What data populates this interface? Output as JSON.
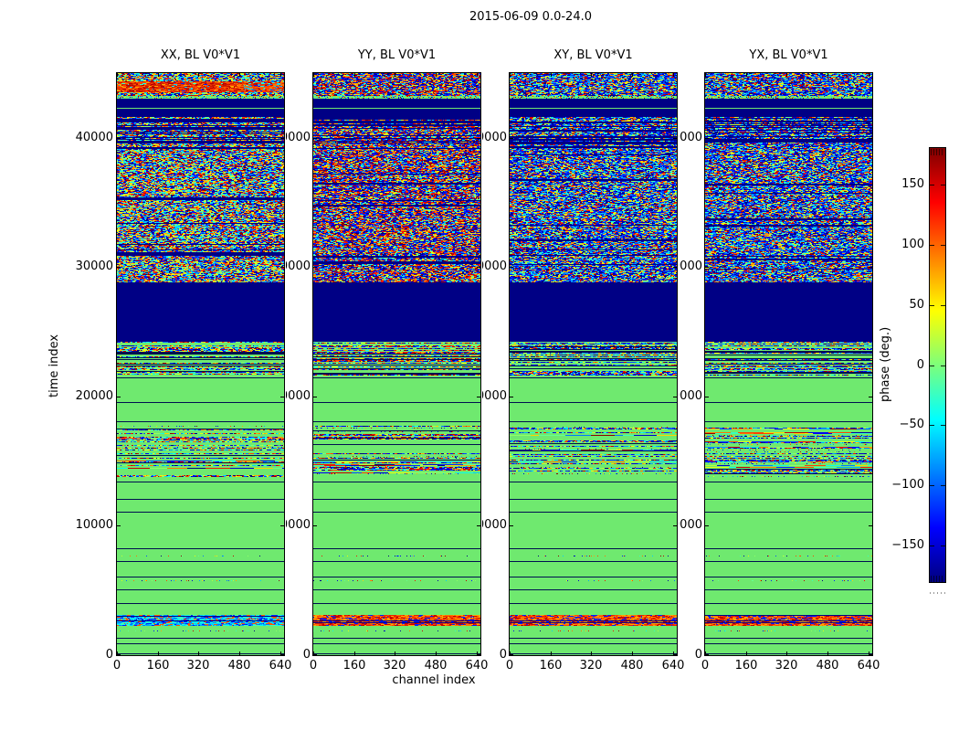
{
  "chart_data": {
    "type": "heatmap",
    "title": "2015-06-09 0.0-24.0",
    "xlabel": "channel index",
    "ylabel": "time index",
    "xlim": [
      0,
      656
    ],
    "ylim": [
      0,
      45000
    ],
    "xticks": [
      0,
      160,
      320,
      480,
      640
    ],
    "yticks": [
      0,
      10000,
      20000,
      30000,
      40000
    ],
    "grid": false,
    "colorbar": {
      "label": "phase (deg.)",
      "ticks": [
        -150,
        -100,
        -50,
        0,
        50,
        100,
        150
      ],
      "tick_labels": [
        "−150",
        "−100",
        "−50",
        "0",
        "50",
        "100",
        "150"
      ],
      "range": [
        -180,
        180
      ],
      "colormap": "jet"
    },
    "panels": [
      {
        "title": "XX, BL V0*V1",
        "seed": 101,
        "bias": "jet",
        "top": "red",
        "low": "cool"
      },
      {
        "title": "YY, BL V0*V1",
        "seed": 202,
        "bias": "redblue",
        "top": "noise",
        "low": "warm"
      },
      {
        "title": "XY, BL V0*V1",
        "seed": 303,
        "bias": "jetblue",
        "top": "noise",
        "low": "warm"
      },
      {
        "title": "YX, BL V0*V1",
        "seed": 404,
        "bias": "jetblue",
        "top": "noise",
        "low": "warm"
      }
    ],
    "bands": [
      {
        "t0": 44520,
        "t1": 45000,
        "type": "noise"
      },
      {
        "t0": 44380,
        "t1": 44520,
        "type": "noise"
      },
      {
        "t0": 43550,
        "t1": 44380,
        "type": "top_variant"
      },
      {
        "t0": 43250,
        "t1": 43550,
        "type": "noise"
      },
      {
        "t0": 43000,
        "t1": 43250,
        "type": "dots"
      },
      {
        "t0": 41600,
        "t1": 43000,
        "type": "navy",
        "green_lines": [
          42300
        ]
      },
      {
        "t0": 39050,
        "t1": 41600,
        "type": "mix_navy"
      },
      {
        "t0": 28800,
        "t1": 39050,
        "type": "noise",
        "navy_lines": 7
      },
      {
        "t0": 24200,
        "t1": 28800,
        "type": "navy"
      },
      {
        "t0": 21600,
        "t1": 24200,
        "type": "mix_rows"
      },
      {
        "t0": 17700,
        "t1": 21600,
        "type": "green",
        "lines": [
          21500,
          19600,
          18100
        ]
      },
      {
        "t0": 13800,
        "t1": 17700,
        "type": "mix_sparse"
      },
      {
        "t0": 3100,
        "t1": 13800,
        "type": "green",
        "lines": [
          13400,
          12100,
          11100,
          8300,
          7300,
          6100,
          5100,
          4000
        ],
        "dot_rows": [
          7700,
          5800
        ]
      },
      {
        "t0": 2250,
        "t1": 3100,
        "type": "low_noise"
      },
      {
        "t0": 1500,
        "t1": 2250,
        "type": "green",
        "dot_rows": [
          1900
        ]
      },
      {
        "t0": 0,
        "t1": 1500,
        "type": "green",
        "lines": [
          1350,
          950,
          150
        ]
      }
    ],
    "colors": {
      "green": "#6fe96f",
      "navy": "#000085",
      "line": "#001050",
      "frame": "#000000",
      "palette_jet": [
        "#00007f",
        "#0000a6",
        "#0000cd",
        "#0000f4",
        "#0020ff",
        "#004cff",
        "#0078ff",
        "#00a4ff",
        "#00d0ff",
        "#0cfcea",
        "#38ffbe",
        "#64ff92",
        "#90ff66",
        "#bcff3a",
        "#e8ff0e",
        "#ffd500",
        "#ffa400",
        "#ff7300",
        "#ff4200",
        "#f11200",
        "#c40000",
        "#8c0000"
      ],
      "reds": [
        "#d42400",
        "#e63400",
        "#ff3b00",
        "#c81400",
        "#ff5500",
        "#b30000"
      ],
      "warm": [
        "#ff4400",
        "#ff7300",
        "#e62000",
        "#ffa400",
        "#c40000",
        "#0020ff"
      ],
      "cool": [
        "#00a4ff",
        "#00d0ff",
        "#0cfcea",
        "#0078ff",
        "#0020ff",
        "#38ffbe",
        "#ff5500"
      ]
    }
  }
}
